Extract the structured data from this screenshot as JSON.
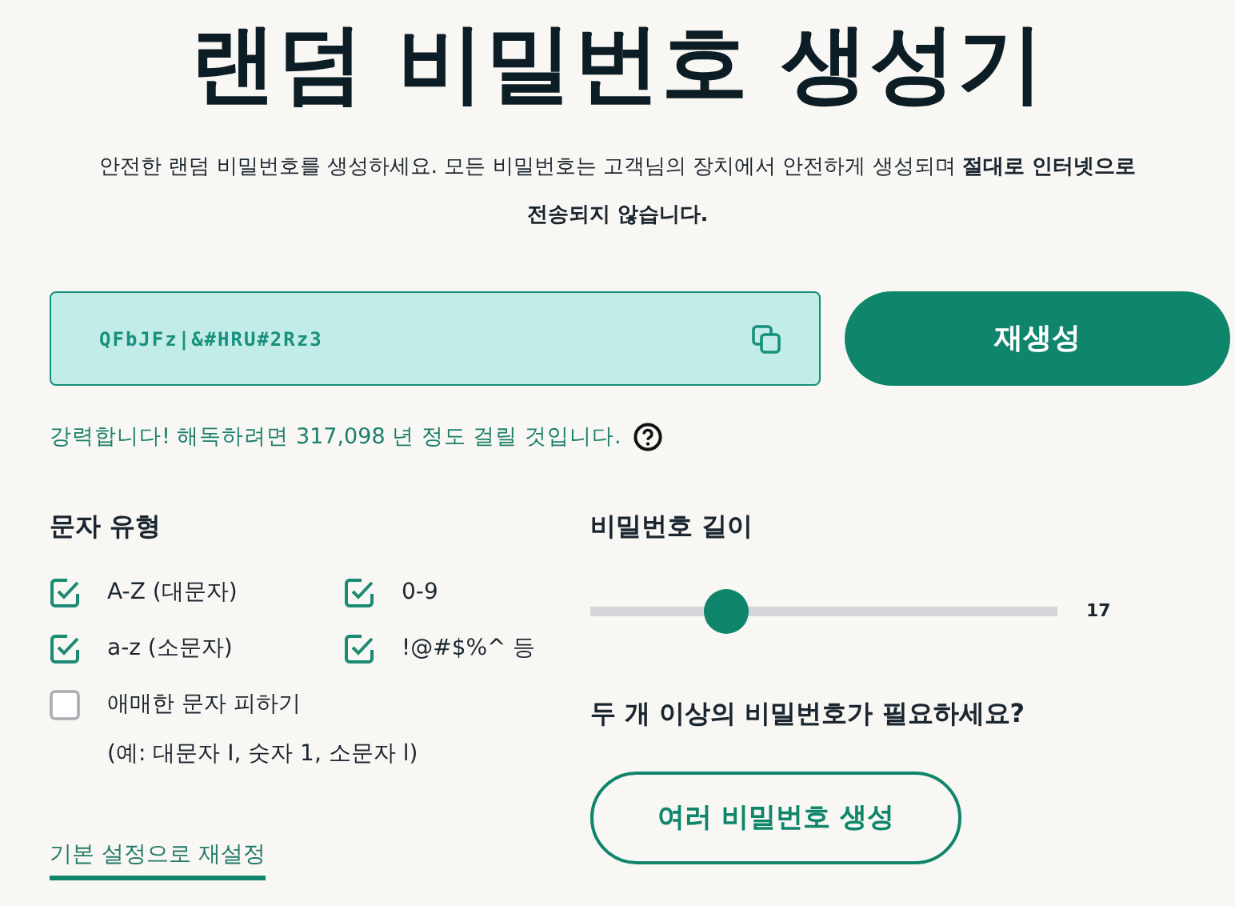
{
  "title": "랜덤 비밀번호 생성기",
  "intro": "안전한 랜덤 비밀번호를 생성하세요. 모든 비밀번호는 고객님의 장치에서 안전하게 생성되며 **절대로 인터넷으로 전송되지 않습니다.**",
  "password": {
    "value": "QFbJFz|&#HRU#2Rz3"
  },
  "regenerate_button": "재생성",
  "strength": "강력합니다! 해독하려면 317,098 년 정도 걸릴 것입니다.",
  "character_types": {
    "heading": "문자 유형",
    "options": [
      {
        "label": "A-Z (대문자)",
        "checked": true
      },
      {
        "label": "0-9",
        "checked": true
      },
      {
        "label": "a-z (소문자)",
        "checked": true
      },
      {
        "label": "!@#$%^ 등",
        "checked": true
      },
      {
        "label": "애매한 문자 피하기",
        "checked": false,
        "note": "(예: 대문자 I, 숫자 1, 소문자 l)"
      }
    ]
  },
  "length": {
    "heading": "비밀번호 길이",
    "level": 0.27,
    "reading": "17"
  },
  "multiple": {
    "question": "두 개 이상의 비밀번호가 필요하세요?",
    "button": "여러 비밀번호 생성"
  },
  "reset_link": "기본 설정으로 재설정"
}
